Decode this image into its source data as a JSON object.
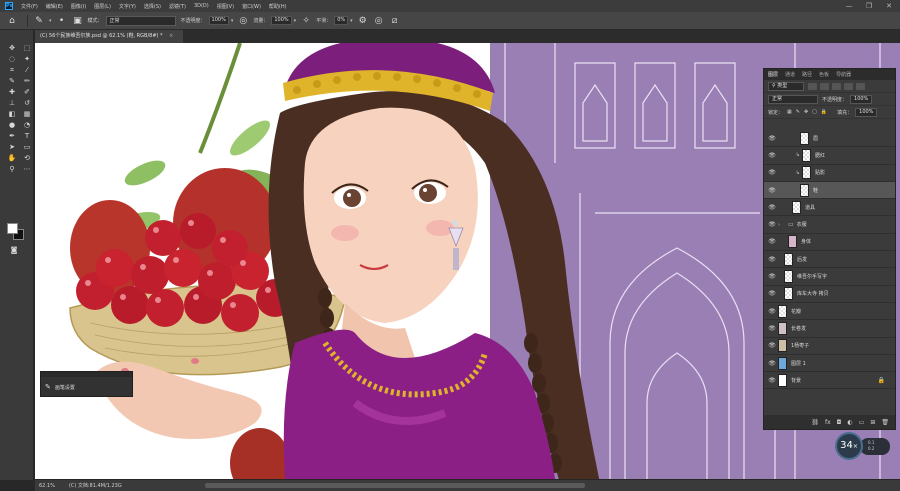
{
  "menu": {
    "logo": "Ps",
    "items": [
      "文件(F)",
      "编辑(E)",
      "图像(I)",
      "图层(L)",
      "文字(Y)",
      "选择(S)",
      "滤镜(T)",
      "3D(D)",
      "视图(V)",
      "窗口(W)",
      "帮助(H)"
    ]
  },
  "options": {
    "mode_label": "模式：",
    "mode_value": "正常",
    "opacity_label": "不透明度：",
    "opacity_value": "100%",
    "flow_label": "流量：",
    "flow_value": "100%",
    "smooth_label": "平滑：",
    "smooth_value": "0%"
  },
  "document": {
    "tab_title": "(C) 56个民族维吾尔族.psd @ 62.1% (鞋, RGB/8#) *",
    "tab_close": "×"
  },
  "status": {
    "zoom": "62.1%",
    "doc_info": "(C) 文档:81.4M/1.23G"
  },
  "brush_panel": {
    "label": "画笔设置"
  },
  "layers_panel": {
    "tabs": [
      "图层",
      "通道",
      "路径",
      "色板",
      "导航器"
    ],
    "kind_label": "类型",
    "blend_mode": "正常",
    "opacity_label": "不透明度：",
    "opacity_value": "100%",
    "lock_label": "锁定：",
    "fill_label": "填充：",
    "fill_value": "100%",
    "layers": [
      {
        "name": "眉",
        "clip": false,
        "folder": false,
        "selected": false
      },
      {
        "name": "腮红",
        "clip": true,
        "folder": false,
        "selected": false
      },
      {
        "name": "贴影",
        "clip": true,
        "folder": false,
        "selected": false
      },
      {
        "name": "鞋",
        "clip": false,
        "folder": false,
        "selected": true
      },
      {
        "name": "道具",
        "clip": false,
        "folder": false,
        "selected": false
      },
      {
        "name": "衣服",
        "clip": false,
        "folder": true,
        "selected": false
      },
      {
        "name": "身体",
        "clip": false,
        "folder": false,
        "selected": false
      },
      {
        "name": "后发",
        "clip": false,
        "folder": false,
        "selected": false
      },
      {
        "name": "维吾尔手写字",
        "clip": false,
        "folder": false,
        "selected": false
      },
      {
        "name": "库车大寺 拷贝",
        "clip": false,
        "folder": false,
        "selected": false
      },
      {
        "name": "花瓣",
        "clip": false,
        "folder": false,
        "selected": false
      },
      {
        "name": "长卷发",
        "clip": false,
        "folder": false,
        "selected": false
      },
      {
        "name": "1杨枣子",
        "clip": false,
        "folder": false,
        "selected": false
      },
      {
        "name": "图层 1",
        "clip": false,
        "folder": false,
        "selected": false
      },
      {
        "name": "背景",
        "clip": false,
        "folder": false,
        "selected": false
      }
    ]
  },
  "badge": {
    "value": "34",
    "suffix": "×",
    "side_lines": [
      "0.1",
      "0.2"
    ]
  },
  "colors": {
    "canvas_purple": "#9a7fb5",
    "cherry_red": "#c2202f",
    "hat_purple": "#7c1f7c",
    "gold": "#e0b42a"
  }
}
